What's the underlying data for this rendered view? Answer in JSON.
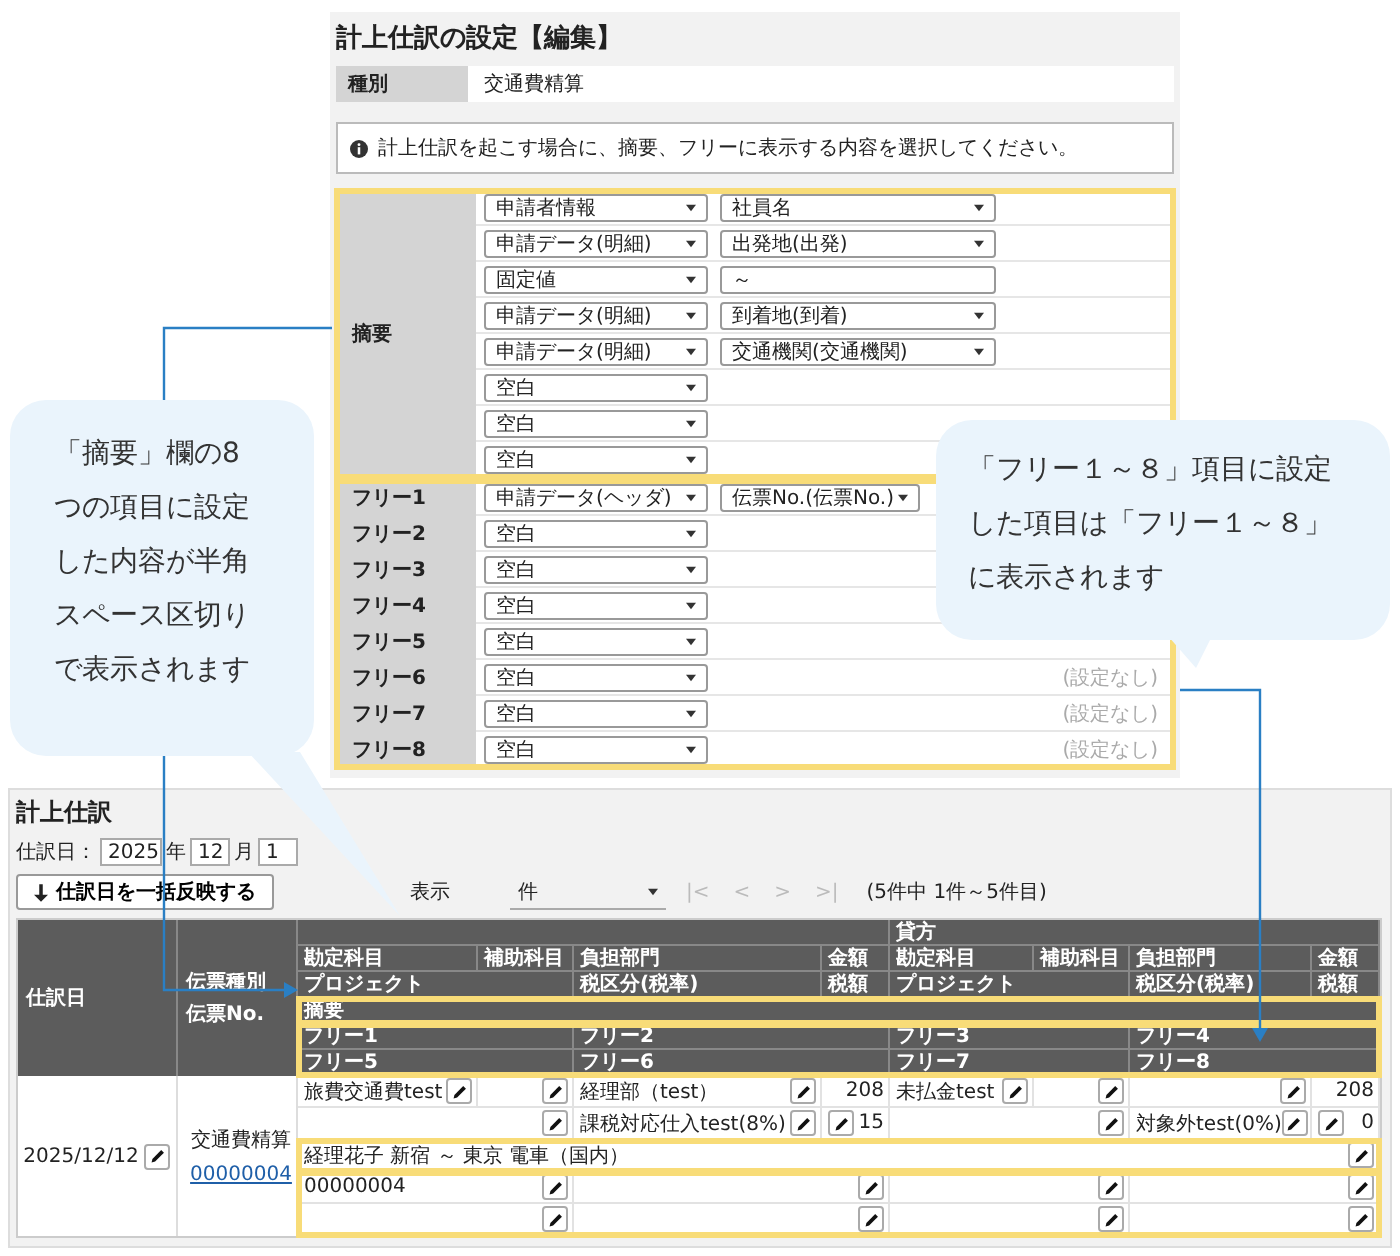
{
  "settings": {
    "title": "計上仕訳の設定【編集】",
    "type_label": "種別",
    "type_value": "交通費精算",
    "info": "計上仕訳を起こす場合に、摘要、フリーに表示する内容を選択してください。",
    "summary": {
      "label": "摘要",
      "items": [
        {
          "kind": "select",
          "source": "申請者情報",
          "field": "社員名"
        },
        {
          "kind": "select",
          "source": "申請データ(明細)",
          "field": "出発地(出発)"
        },
        {
          "kind": "text",
          "source": "固定値",
          "field": "～"
        },
        {
          "kind": "select",
          "source": "申請データ(明細)",
          "field": "到着地(到着)"
        },
        {
          "kind": "select",
          "source": "申請データ(明細)",
          "field": "交通機関(交通機関)"
        },
        {
          "kind": "single",
          "source": "空白"
        },
        {
          "kind": "single",
          "source": "空白"
        },
        {
          "kind": "single",
          "source": "空白"
        }
      ]
    },
    "free": [
      {
        "kind": "select",
        "label": "フリー1",
        "source": "申請データ(ヘッダ)",
        "field": "伝票No.(伝票No.)"
      },
      {
        "kind": "single",
        "label": "フリー2",
        "source": "空白"
      },
      {
        "kind": "single",
        "label": "フリー3",
        "source": "空白"
      },
      {
        "kind": "single",
        "label": "フリー4",
        "source": "空白"
      },
      {
        "kind": "single",
        "label": "フリー5",
        "source": "空白"
      },
      {
        "kind": "single",
        "label": "フリー6",
        "source": "空白",
        "note": "(設定なし)"
      },
      {
        "kind": "single",
        "label": "フリー7",
        "source": "空白",
        "note": "(設定なし)"
      },
      {
        "kind": "single",
        "label": "フリー8",
        "source": "空白",
        "note": "(設定なし)"
      }
    ]
  },
  "callouts": [
    {
      "text": "「摘要」欄の8つの項目に設定した内容が半角スペース区切りで表示されます"
    },
    {
      "text": "「フリー１～８」項目に設定した項目は「フリー１～８」に表示されます"
    }
  ],
  "journal": {
    "title": "計上仕訳",
    "date_label": "仕訳日：",
    "year": "2025",
    "year_unit": "年",
    "month": "12",
    "month_unit": "月",
    "day": "1",
    "apply_button": "仕訳日を一括反映する",
    "per_page_label": "表示",
    "per_page": "件",
    "pager": [
      {
        "label": "|<",
        "disabled": true
      },
      {
        "label": "<",
        "disabled": true
      },
      {
        "label": ">",
        "disabled": true
      },
      {
        "label": ">|",
        "disabled": true
      }
    ],
    "range": "(5件中 1件～5件目)",
    "header": {
      "date": "仕訳日",
      "slip_type": "伝票種別",
      "slip_no": "伝票No.",
      "credit": "貸方",
      "columns": [
        "勘定科目",
        "補助科目",
        "負担部門",
        "金額",
        "勘定科目",
        "補助科目",
        "負担部門",
        "金額"
      ],
      "tax_columns": [
        "プロジェクト",
        "税区分(税率)",
        "税額",
        "プロジェクト",
        "税区分(税率)",
        "税額"
      ],
      "summary": "摘要",
      "free": [
        "フリー1",
        "フリー2",
        "フリー3",
        "フリー4",
        "フリー5",
        "フリー6",
        "フリー7",
        "フリー8"
      ]
    },
    "entries": [
      {
        "date": "2025/12/12",
        "slip_type": "交通費精算",
        "slip_no": "00000004",
        "lines": [
          {
            "kind": "main",
            "cells": [
              {
                "text": "旅費交通費test",
                "editable": true
              },
              {
                "editable": true
              },
              {
                "text": "経理部（test）",
                "editable": true
              },
              {
                "text": "208",
                "editable": false
              },
              {
                "text": "未払金test",
                "editable": true
              },
              {
                "editable": true
              },
              {
                "editable": true
              },
              {
                "text": "208",
                "editable": false
              }
            ]
          },
          {
            "kind": "tax",
            "cells": [
              {
                "editable": true
              },
              {
                "text": "課税対応仕入test(8%)",
                "editable": true
              },
              {
                "text": "15",
                "editable": true
              },
              {
                "editable": true
              },
              {
                "text": "対象外test(0%)",
                "editable": true
              },
              {
                "text": "0",
                "editable": true
              }
            ]
          },
          {
            "kind": "summary",
            "cells": [
              {
                "text": "経理花子 新宿 ～ 東京 電車（国内）",
                "editable": true
              }
            ]
          },
          {
            "kind": "free",
            "cells": [
              {
                "text": "00000004",
                "editable": true
              },
              {
                "editable": true
              },
              {
                "editable": true
              },
              {
                "editable": true
              }
            ]
          },
          {
            "kind": "free",
            "cells": [
              {
                "editable": true
              },
              {
                "editable": true
              },
              {
                "editable": true
              },
              {
                "editable": true
              }
            ]
          }
        ]
      }
    ]
  }
}
